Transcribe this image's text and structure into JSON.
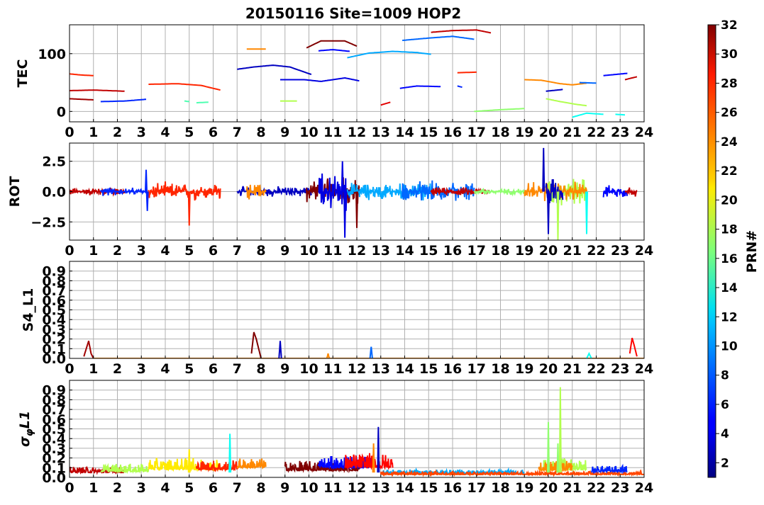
{
  "title": "20150116 Site=1009 HOP2",
  "colorbar": {
    "label": "PRN#",
    "ticks": [
      2,
      4,
      6,
      8,
      10,
      12,
      14,
      16,
      18,
      20,
      22,
      24,
      26,
      28,
      30,
      32
    ],
    "range": [
      1,
      32
    ]
  },
  "chart_data": [
    {
      "type": "line",
      "ylabel": "TEC",
      "xlim": [
        0,
        24
      ],
      "ylim": [
        -18,
        150
      ],
      "yticks": [
        0,
        100
      ],
      "xticks": [
        0,
        1,
        2,
        3,
        4,
        5,
        6,
        7,
        8,
        9,
        10,
        11,
        12,
        13,
        14,
        15,
        16,
        17,
        18,
        19,
        20,
        21,
        22,
        23,
        24
      ],
      "grid": true,
      "series": [
        {
          "prn": 27,
          "x": [
            0.0,
            0.5,
            1.0
          ],
          "y": [
            65,
            63,
            62
          ]
        },
        {
          "prn": 30,
          "x": [
            0.0,
            1.0,
            2.3
          ],
          "y": [
            36,
            37,
            35
          ]
        },
        {
          "prn": 31,
          "x": [
            0.0,
            0.5,
            1.0
          ],
          "y": [
            22,
            21,
            20
          ]
        },
        {
          "prn": 6,
          "x": [
            1.3,
            2.3,
            3.2
          ],
          "y": [
            17,
            18,
            21
          ]
        },
        {
          "prn": 27,
          "x": [
            3.3,
            4.5,
            5.5,
            6.3
          ],
          "y": [
            47,
            48,
            45,
            37
          ]
        },
        {
          "prn": 15,
          "x": [
            4.8,
            5.0
          ],
          "y": [
            18,
            17
          ]
        },
        {
          "prn": 15,
          "x": [
            5.3,
            5.8
          ],
          "y": [
            15,
            16
          ]
        },
        {
          "prn": 3,
          "x": [
            7.0,
            7.7,
            8.5,
            9.2,
            10.1
          ],
          "y": [
            73,
            77,
            80,
            77,
            64
          ]
        },
        {
          "prn": 24,
          "x": [
            7.4,
            8.2
          ],
          "y": [
            108,
            108
          ]
        },
        {
          "prn": 18,
          "x": [
            8.8,
            9.5
          ],
          "y": [
            18,
            18
          ]
        },
        {
          "prn": 4,
          "x": [
            8.8,
            9.8,
            10.5,
            11.5,
            12.1
          ],
          "y": [
            55,
            55,
            52,
            58,
            53
          ]
        },
        {
          "prn": 32,
          "x": [
            9.9,
            10.5,
            11.5,
            12.0
          ],
          "y": [
            110,
            122,
            122,
            113
          ]
        },
        {
          "prn": 5,
          "x": [
            10.4,
            11.0,
            11.7
          ],
          "y": [
            105,
            107,
            104
          ]
        },
        {
          "prn": 10,
          "x": [
            11.6,
            12.5,
            13.5,
            14.5,
            15.1
          ],
          "y": [
            93,
            101,
            104,
            102,
            99
          ]
        },
        {
          "prn": 29,
          "x": [
            13.0,
            13.4
          ],
          "y": [
            11,
            16
          ]
        },
        {
          "prn": 5,
          "x": [
            13.8,
            14.5,
            15.5
          ],
          "y": [
            40,
            44,
            43
          ]
        },
        {
          "prn": 8,
          "x": [
            13.9,
            15.0,
            16.0,
            16.9
          ],
          "y": [
            123,
            127,
            130,
            125
          ]
        },
        {
          "prn": 30,
          "x": [
            15.1,
            16.0,
            17.0,
            17.6
          ],
          "y": [
            137,
            140,
            141,
            136
          ]
        },
        {
          "prn": 6,
          "x": [
            16.2,
            16.4
          ],
          "y": [
            44,
            42
          ]
        },
        {
          "prn": 27,
          "x": [
            16.2,
            17.0
          ],
          "y": [
            67,
            68
          ]
        },
        {
          "prn": 17,
          "x": [
            16.9,
            18.0,
            19.0
          ],
          "y": [
            0,
            3,
            5
          ]
        },
        {
          "prn": 24,
          "x": [
            19.0,
            19.7,
            20.5,
            21.0,
            21.6
          ],
          "y": [
            55,
            54,
            48,
            46,
            49
          ]
        },
        {
          "prn": 3,
          "x": [
            19.9,
            20.6
          ],
          "y": [
            35,
            38
          ]
        },
        {
          "prn": 18,
          "x": [
            19.9,
            20.5,
            21.2,
            21.6
          ],
          "y": [
            22,
            17,
            12,
            10
          ]
        },
        {
          "prn": 13,
          "x": [
            21.0,
            21.6,
            22.3
          ],
          "y": [
            -10,
            -3,
            -5
          ]
        },
        {
          "prn": 8,
          "x": [
            21.3,
            22.0
          ],
          "y": [
            50,
            49
          ]
        },
        {
          "prn": 13,
          "x": [
            22.8,
            23.2
          ],
          "y": [
            -5,
            -6
          ]
        },
        {
          "prn": 5,
          "x": [
            22.3,
            23.3
          ],
          "y": [
            62,
            66
          ]
        },
        {
          "prn": 30,
          "x": [
            23.2,
            23.7
          ],
          "y": [
            55,
            60
          ]
        }
      ]
    },
    {
      "type": "line",
      "ylabel": "ROT",
      "xlim": [
        0,
        24
      ],
      "ylim": [
        -4,
        4
      ],
      "yticks": [
        -2.5,
        0.0,
        2.5
      ],
      "ytick_labels": [
        "−2.5",
        "0.0",
        "2.5"
      ],
      "xticks": [
        0,
        1,
        2,
        3,
        4,
        5,
        6,
        7,
        8,
        9,
        10,
        11,
        12,
        13,
        14,
        15,
        16,
        17,
        18,
        19,
        20,
        21,
        22,
        23,
        24
      ],
      "grid": true,
      "series": [
        {
          "prn": 30,
          "x": [
            0.0,
            2.3
          ],
          "y": [
            0,
            0
          ],
          "amp": 0.4
        },
        {
          "prn": 6,
          "x": [
            1.3,
            3.2
          ],
          "y": [
            0,
            0
          ],
          "amp": 0.4
        },
        {
          "prn": 27,
          "x": [
            3.3,
            6.3
          ],
          "y": [
            0,
            0
          ],
          "amp": 0.9
        },
        {
          "prn": 3,
          "x": [
            7.0,
            10.1
          ],
          "y": [
            0,
            0
          ],
          "amp": 0.5
        },
        {
          "prn": 24,
          "x": [
            7.4,
            8.2
          ],
          "y": [
            0,
            0
          ],
          "amp": 0.8
        },
        {
          "prn": 32,
          "x": [
            9.9,
            12.1
          ],
          "y": [
            0,
            0
          ],
          "amp": 1.5
        },
        {
          "prn": 4,
          "x": [
            10.4,
            11.7
          ],
          "y": [
            0,
            0
          ],
          "amp": 1.8
        },
        {
          "prn": 10,
          "x": [
            11.6,
            15.1
          ],
          "y": [
            0,
            0
          ],
          "amp": 0.9
        },
        {
          "prn": 8,
          "x": [
            13.9,
            16.9
          ],
          "y": [
            0,
            0
          ],
          "amp": 1.0
        },
        {
          "prn": 30,
          "x": [
            15.1,
            17.6
          ],
          "y": [
            0,
            0
          ],
          "amp": 0.4
        },
        {
          "prn": 17,
          "x": [
            16.9,
            19.0
          ],
          "y": [
            0,
            0
          ],
          "amp": 0.3
        },
        {
          "prn": 18,
          "x": [
            19.9,
            21.6
          ],
          "y": [
            0,
            0
          ],
          "amp": 1.4
        },
        {
          "prn": 24,
          "x": [
            19.0,
            21.6
          ],
          "y": [
            0,
            0
          ],
          "amp": 1.0
        },
        {
          "prn": 3,
          "x": [
            19.9,
            20.6
          ],
          "y": [
            0,
            0
          ],
          "amp": 1.6
        },
        {
          "prn": 5,
          "x": [
            22.3,
            23.3
          ],
          "y": [
            0,
            0
          ],
          "amp": 0.6
        },
        {
          "prn": 30,
          "x": [
            23.2,
            23.7
          ],
          "y": [
            0,
            0
          ],
          "amp": 0.5
        }
      ],
      "spikes": [
        {
          "prn": 6,
          "x": 3.2,
          "y": 1.8
        },
        {
          "prn": 6,
          "x": 3.25,
          "y": -1.6
        },
        {
          "prn": 27,
          "x": 5.0,
          "y": -2.8
        },
        {
          "prn": 4,
          "x": 11.4,
          "y": 2.5
        },
        {
          "prn": 4,
          "x": 11.5,
          "y": -3.8
        },
        {
          "prn": 32,
          "x": 12.0,
          "y": -3.0
        },
        {
          "prn": 3,
          "x": 19.8,
          "y": 3.6
        },
        {
          "prn": 3,
          "x": 20.0,
          "y": -3.5
        },
        {
          "prn": 18,
          "x": 20.4,
          "y": -4.0
        },
        {
          "prn": 13,
          "x": 21.6,
          "y": -3.5
        }
      ]
    },
    {
      "type": "line",
      "ylabel": "S4_L1",
      "xlim": [
        0,
        24
      ],
      "ylim": [
        0,
        1
      ],
      "yticks": [
        0.0,
        0.1,
        0.2,
        0.3,
        0.4,
        0.5,
        0.6,
        0.7,
        0.8,
        0.9
      ],
      "ytick_labels": [
        "0.0",
        "0.1",
        "0.2",
        "0.3",
        "0.4",
        "0.5",
        "0.6",
        "0.7",
        "0.8",
        "0.9"
      ],
      "xticks": [
        0,
        1,
        2,
        3,
        4,
        5,
        6,
        7,
        8,
        9,
        10,
        11,
        12,
        13,
        14,
        15,
        16,
        17,
        18,
        19,
        20,
        21,
        22,
        23,
        24
      ],
      "grid": true,
      "series": [
        {
          "prn": 31,
          "x": [
            0.6,
            0.75,
            0.8,
            0.9,
            1.0
          ],
          "y": [
            0.02,
            0.14,
            0.18,
            0.05,
            0.0
          ]
        },
        {
          "prn": 24,
          "x": [
            1.0,
            24.0
          ],
          "y": [
            0.0,
            0.0
          ]
        },
        {
          "prn": 32,
          "x": [
            7.6,
            7.7,
            7.8,
            7.9,
            8.0
          ],
          "y": [
            0.05,
            0.27,
            0.2,
            0.1,
            0.0
          ]
        },
        {
          "prn": 3,
          "x": [
            8.75,
            8.8,
            8.85
          ],
          "y": [
            0.0,
            0.18,
            0.0
          ]
        },
        {
          "prn": 24,
          "x": [
            10.75,
            10.8,
            10.85
          ],
          "y": [
            0.0,
            0.05,
            0.0
          ]
        },
        {
          "prn": 8,
          "x": [
            12.55,
            12.6,
            12.65
          ],
          "y": [
            0.0,
            0.12,
            0.0
          ]
        },
        {
          "prn": 13,
          "x": [
            21.6,
            21.7,
            21.8
          ],
          "y": [
            0.0,
            0.05,
            0.0
          ]
        },
        {
          "prn": 28,
          "x": [
            23.4,
            23.5,
            23.6,
            23.7
          ],
          "y": [
            0.05,
            0.21,
            0.12,
            0.02
          ]
        }
      ]
    },
    {
      "type": "line",
      "ylabel": "σ_φL1",
      "ylabel_main": "σ",
      "ylabel_sub": "φ",
      "ylabel_rest": "L1",
      "xlim": [
        0,
        24
      ],
      "ylim": [
        0,
        1
      ],
      "yticks": [
        0.0,
        0.1,
        0.2,
        0.3,
        0.4,
        0.5,
        0.6,
        0.7,
        0.8,
        0.9
      ],
      "ytick_labels": [
        "0.0",
        "0.1",
        "0.2",
        "0.3",
        "0.4",
        "0.5",
        "0.6",
        "0.7",
        "0.8",
        "0.9"
      ],
      "xticks": [
        0,
        1,
        2,
        3,
        4,
        5,
        6,
        7,
        8,
        9,
        10,
        11,
        12,
        13,
        14,
        15,
        16,
        17,
        18,
        19,
        20,
        21,
        22,
        23,
        24
      ],
      "grid": true,
      "series": [
        {
          "prn": 30,
          "x": [
            0.0,
            2.3
          ],
          "y": [
            0.05,
            0.05
          ],
          "amp": 0.06
        },
        {
          "prn": 18,
          "x": [
            1.3,
            3.3
          ],
          "y": [
            0.06,
            0.06
          ],
          "amp": 0.08
        },
        {
          "prn": 21,
          "x": [
            3.3,
            6.3
          ],
          "y": [
            0.08,
            0.08
          ],
          "amp": 0.12
        },
        {
          "prn": 27,
          "x": [
            5.3,
            7.0
          ],
          "y": [
            0.08,
            0.08
          ],
          "amp": 0.1
        },
        {
          "prn": 24,
          "x": [
            7.0,
            8.2
          ],
          "y": [
            0.1,
            0.1
          ],
          "amp": 0.1
        },
        {
          "prn": 32,
          "x": [
            9.0,
            12.1
          ],
          "y": [
            0.07,
            0.07
          ],
          "amp": 0.1
        },
        {
          "prn": 5,
          "x": [
            10.4,
            12.6
          ],
          "y": [
            0.1,
            0.1
          ],
          "amp": 0.12
        },
        {
          "prn": 28,
          "x": [
            11.5,
            13.5
          ],
          "y": [
            0.1,
            0.1
          ],
          "amp": 0.15
        },
        {
          "prn": 10,
          "x": [
            13.0,
            19.0
          ],
          "y": [
            0.04,
            0.04
          ],
          "amp": 0.04
        },
        {
          "prn": 26,
          "x": [
            13.0,
            24.0
          ],
          "y": [
            0.03,
            0.03
          ],
          "amp": 0.03
        },
        {
          "prn": 18,
          "x": [
            19.8,
            21.6
          ],
          "y": [
            0.08,
            0.08
          ],
          "amp": 0.12
        },
        {
          "prn": 24,
          "x": [
            19.6,
            21.0
          ],
          "y": [
            0.07,
            0.07
          ],
          "amp": 0.1
        },
        {
          "prn": 6,
          "x": [
            21.8,
            23.3
          ],
          "y": [
            0.06,
            0.06
          ],
          "amp": 0.06
        }
      ],
      "spikes": [
        {
          "prn": 21,
          "x": 5.0,
          "y": 0.29
        },
        {
          "prn": 13,
          "x": 6.7,
          "y": 0.45
        },
        {
          "prn": 24,
          "x": 12.7,
          "y": 0.35
        },
        {
          "prn": 3,
          "x": 12.9,
          "y": 0.52
        },
        {
          "prn": 17,
          "x": 20.0,
          "y": 0.57
        },
        {
          "prn": 18,
          "x": 20.5,
          "y": 0.93
        },
        {
          "prn": 17,
          "x": 20.4,
          "y": 0.35
        }
      ]
    }
  ]
}
